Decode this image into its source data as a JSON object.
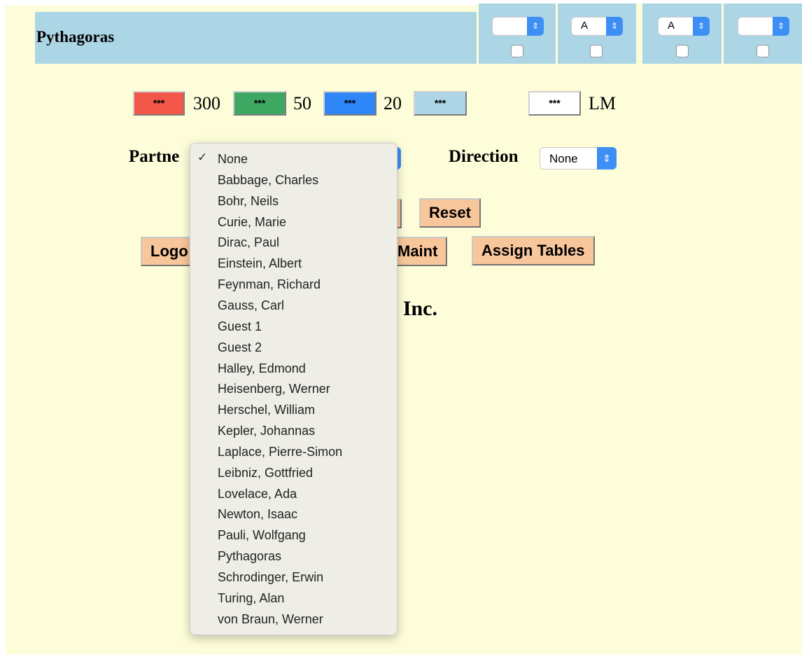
{
  "header": {
    "name": "Pythagoras",
    "selects": [
      "",
      "A",
      "A",
      ""
    ],
    "select_arrow": "⇕"
  },
  "buttons_row": {
    "colors": [
      {
        "label": "***",
        "value": "300",
        "color": "#f2574a"
      },
      {
        "label": "***",
        "value": "50",
        "color": "#3ea863"
      },
      {
        "label": "***",
        "value": "20",
        "color": "#2f86f6"
      },
      {
        "label": "***",
        "value": "",
        "color": "#acd5e6"
      }
    ],
    "lm_button_label": "***",
    "lm_label": "LM"
  },
  "partner": {
    "label": "Partne",
    "selected": "None"
  },
  "direction": {
    "label": "Direction",
    "value": "None"
  },
  "actions": {
    "reset": "Reset",
    "logout_partial": "Logo",
    "maint_partial": "Maint",
    "assign_tables": "Assign Tables"
  },
  "company_partial": "co Inc.",
  "dropdown": {
    "check": "✓",
    "options": [
      "None",
      "Babbage, Charles",
      "Bohr, Neils",
      "Curie, Marie",
      "Dirac, Paul",
      "Einstein, Albert",
      "Feynman, Richard",
      "Gauss, Carl",
      "Guest 1",
      "Guest 2",
      "Halley, Edmond",
      "Heisenberg, Werner",
      "Herschel, William",
      "Kepler, Johannas",
      "Laplace, Pierre-Simon",
      "Leibniz, Gottfried",
      "Lovelace, Ada",
      "Newton, Isaac",
      "Pauli, Wolfgang",
      "Pythagoras",
      "Schrodinger, Erwin",
      "Turing, Alan",
      "von Braun, Werner"
    ]
  }
}
